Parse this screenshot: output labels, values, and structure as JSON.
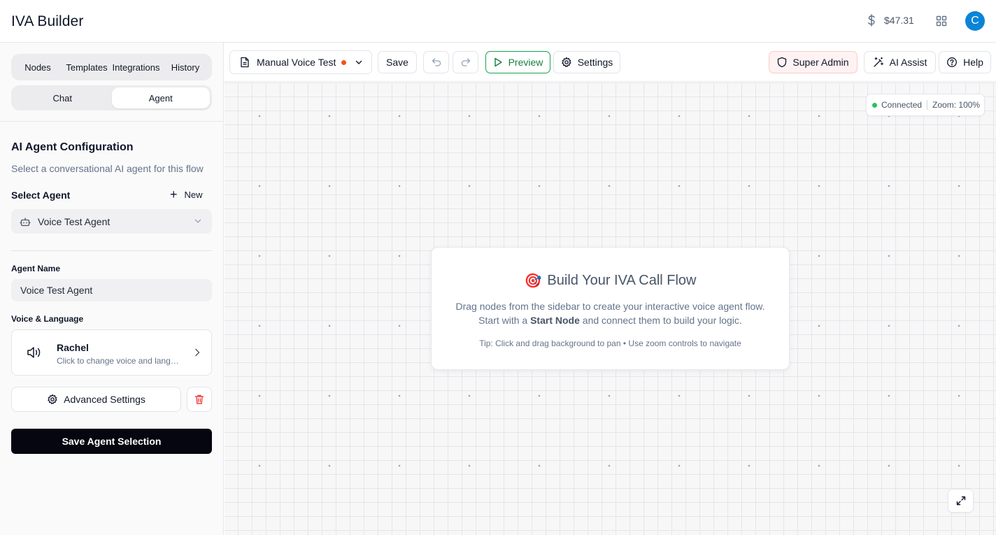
{
  "header": {
    "title": "IVA Builder",
    "balance": "$47.31",
    "avatar_initial": "C"
  },
  "sidebar": {
    "main_tabs": [
      {
        "label": "Nodes"
      },
      {
        "label": "Templates"
      },
      {
        "label": "Integrations"
      },
      {
        "label": "History"
      }
    ],
    "sub_tabs": [
      {
        "label": "Chat",
        "active": false
      },
      {
        "label": "Agent",
        "active": true
      }
    ],
    "config": {
      "title": "AI Agent Configuration",
      "description": "Select a conversational AI agent for this flow",
      "select_label": "Select Agent",
      "new_label": "New",
      "selected_agent": "Voice Test Agent",
      "name_label": "Agent Name",
      "name_value": "Voice Test Agent",
      "voice_label": "Voice & Language",
      "voice_name": "Rachel",
      "voice_hint": "Click to change voice and language",
      "advanced_label": "Advanced Settings",
      "save_label": "Save Agent Selection"
    }
  },
  "toolbar": {
    "flow_name": "Manual Voice Test",
    "save_label": "Save",
    "preview_label": "Preview",
    "settings_label": "Settings",
    "admin_label": "Super Admin",
    "ai_label": "AI Assist",
    "help_label": "Help"
  },
  "canvas": {
    "status": "Connected",
    "zoom": "Zoom: 100%",
    "welcome": {
      "emoji": "🎯",
      "title": "Build Your IVA Call Flow",
      "line1": "Drag nodes from the sidebar to create your interactive voice agent flow.",
      "line2_prefix": "Start with a ",
      "line2_bold": "Start Node",
      "line2_suffix": " and connect them to build your logic.",
      "tip": "Tip: Click and drag background to pan • Use zoom controls to navigate"
    }
  },
  "colors": {
    "accent_blue": "#0b84d8",
    "preview_green": "#16a34a",
    "unsaved_dot": "#f4511e",
    "connected_green": "#22c55e",
    "admin_bg": "#fef2f2",
    "delete_red": "#ef4444"
  }
}
